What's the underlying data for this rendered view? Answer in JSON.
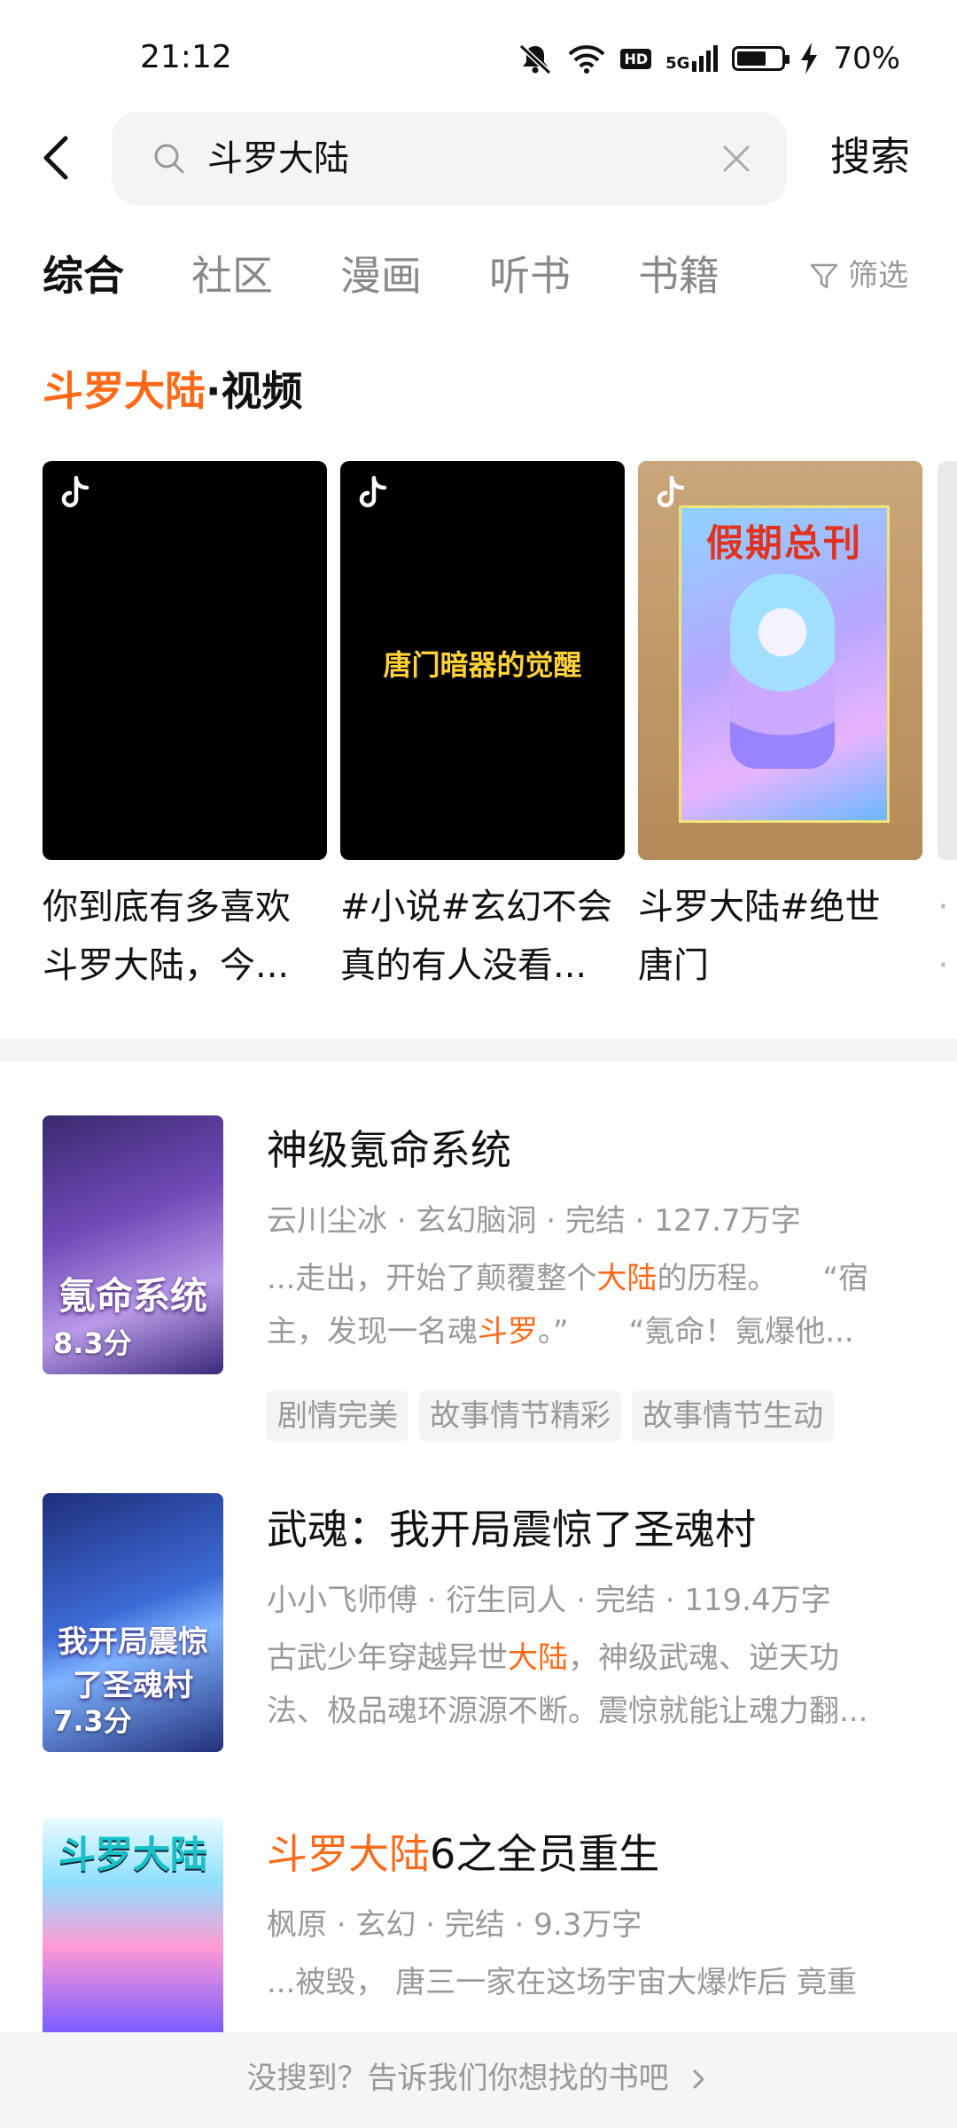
{
  "status_bar": {
    "time": "21:12",
    "battery": "70%",
    "battery_level": 0.7,
    "network_badge": "HD",
    "network_type": "5G",
    "icons": [
      "mute-icon",
      "wifi-icon",
      "hd-icon",
      "signal-5g-icon",
      "battery-icon",
      "charging-icon"
    ]
  },
  "search": {
    "query": "斗罗大陆",
    "button": "搜索"
  },
  "tabs": [
    "综合",
    "社区",
    "漫画",
    "听书",
    "书籍"
  ],
  "active_tab": "综合",
  "filter": {
    "label": "筛选"
  },
  "video_section": {
    "keyword": "斗罗大陆",
    "suffix": "·视频",
    "cards": [
      {
        "caption_line1": "你到底有多喜欢",
        "caption_line2": "斗罗大陆，今..."
      },
      {
        "overlay_text": "唐门暗器的觉醒",
        "caption_line1": "#小说#玄幻不会",
        "caption_line2": "真的有人没看..."
      },
      {
        "cover_text": "假期总刊",
        "caption_line1": "斗罗大陆#绝世",
        "caption_line2": "唐门"
      }
    ]
  },
  "books": [
    {
      "title": "神级氪命系统",
      "meta": "云川尘冰 · 玄幻脑洞 · 完结 · 127.7万字",
      "score": "8.3分",
      "cover_text": "氪命系统",
      "desc_line1": [
        {
          "t": "...走出，开始了颠覆整个",
          "hl": false
        },
        {
          "t": "大陆",
          "hl": true
        },
        {
          "t": "的历程。　　“宿",
          "hl": false
        }
      ],
      "desc_line2": [
        {
          "t": "主，发现一名魂",
          "hl": false
        },
        {
          "t": "斗罗",
          "hl": true
        },
        {
          "t": "。”　　“氪命！氪爆他...",
          "hl": false
        }
      ],
      "tags": [
        "剧情完美",
        "故事情节精彩",
        "故事情节生动"
      ]
    },
    {
      "title": "武魂：我开局震惊了圣魂村",
      "meta": "小小飞师傅 · 衍生同人 · 完结 · 119.4万字",
      "score": "7.3分",
      "cover_text": "我开局震惊了圣魂村",
      "desc_line1": [
        {
          "t": "古武少年穿越异世",
          "hl": false
        },
        {
          "t": "大陆",
          "hl": true
        },
        {
          "t": "，神级武魂、逆天功",
          "hl": false
        }
      ],
      "desc_line2": [
        {
          "t": "法、极品魂环源源不断。震惊就能让魂力翻...",
          "hl": false
        }
      ]
    },
    {
      "title_hl": "斗罗大陆",
      "title_rest": "6之全员重生",
      "meta": "枫原 · 玄幻 · 完结 · 9.3万字",
      "cover_text": "斗罗大陆",
      "desc_line1": [
        {
          "t": "...被毁， 唐三一家在这场宇宙大爆炸后 竟重",
          "hl": false
        }
      ]
    }
  ],
  "feedback": "没搜到？告诉我们你想找的书吧",
  "colors": {
    "accent": "#ff6a1a",
    "muted": "#999999",
    "chip_bg": "#f4f4f4"
  }
}
